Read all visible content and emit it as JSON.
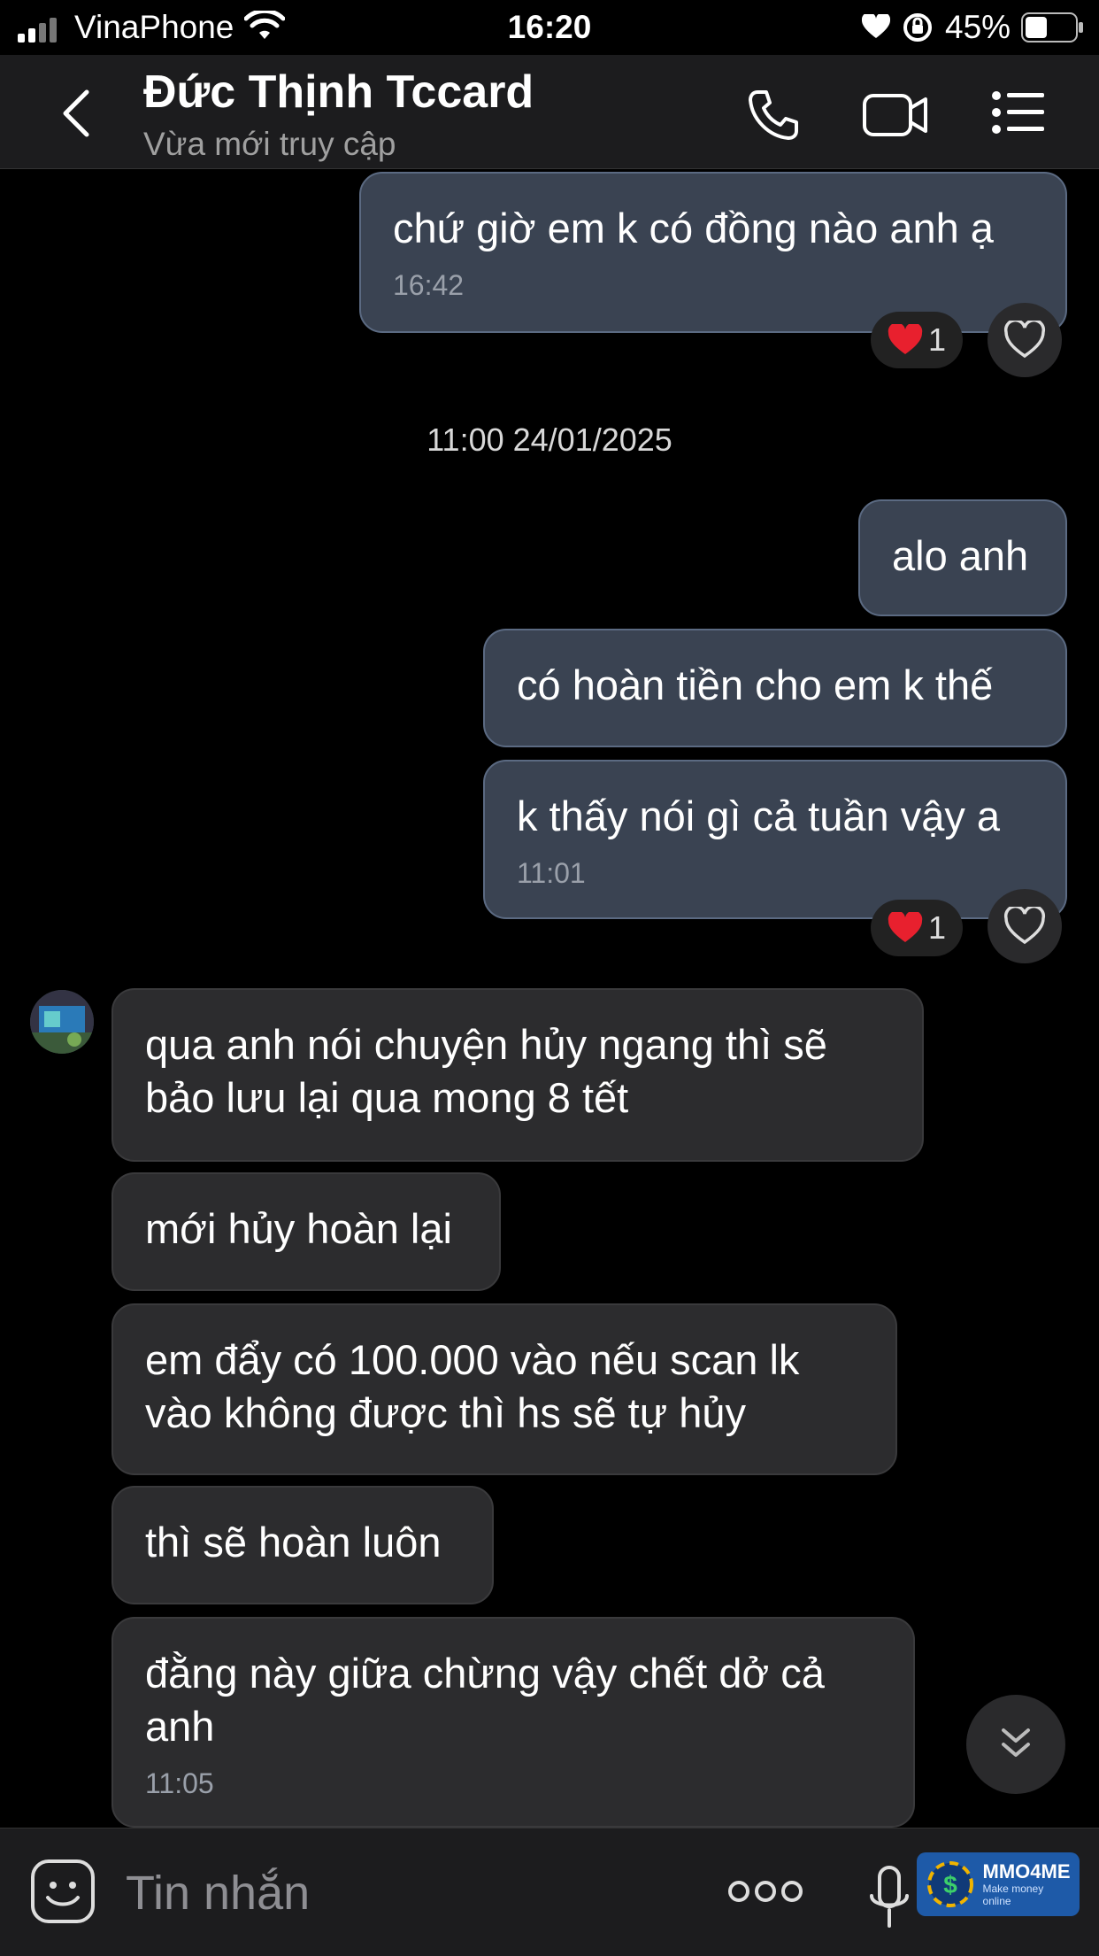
{
  "status_bar": {
    "carrier": "VinaPhone",
    "time": "16:20",
    "battery": "45%"
  },
  "header": {
    "title": "Đức Thịnh Tccard",
    "subtitle": "Vừa mới truy cập"
  },
  "messages": {
    "m1": {
      "text": "chứ giờ em k có đồng nào anh ạ",
      "time": "16:42",
      "reaction_count": "1"
    },
    "date_separator": "11:00 24/01/2025",
    "m2": {
      "text": "alo anh"
    },
    "m3": {
      "text": "có hoàn tiền cho em k thế"
    },
    "m4": {
      "text": "k thấy nói gì cả tuần vậy a",
      "time": "11:01",
      "reaction_count": "1"
    },
    "m5": {
      "line1": "qua anh nói chuyện hủy ngang thì sẽ",
      "line2": "bảo lưu lại qua mong 8 tết"
    },
    "m6": {
      "text": "mới hủy hoàn lại"
    },
    "m7": {
      "line1": "em đẩy có 100.000 vào nếu scan lk",
      "line2": "vào không được thì hs sẽ tự hủy"
    },
    "m8": {
      "text": "thì sẽ hoàn luôn"
    },
    "m9": {
      "line1": "đằng này giữa chừng vậy chết dở cả",
      "line2": "anh",
      "time": "11:05"
    }
  },
  "composer": {
    "placeholder": "Tin nhắn"
  },
  "watermark": {
    "brand": "MMO4ME",
    "tagline": "Make money online"
  },
  "colors": {
    "outgoing_bubble": "#3a4352",
    "incoming_bubble": "#2c2c2e",
    "background": "#000000",
    "header": "#1c1c1e"
  }
}
